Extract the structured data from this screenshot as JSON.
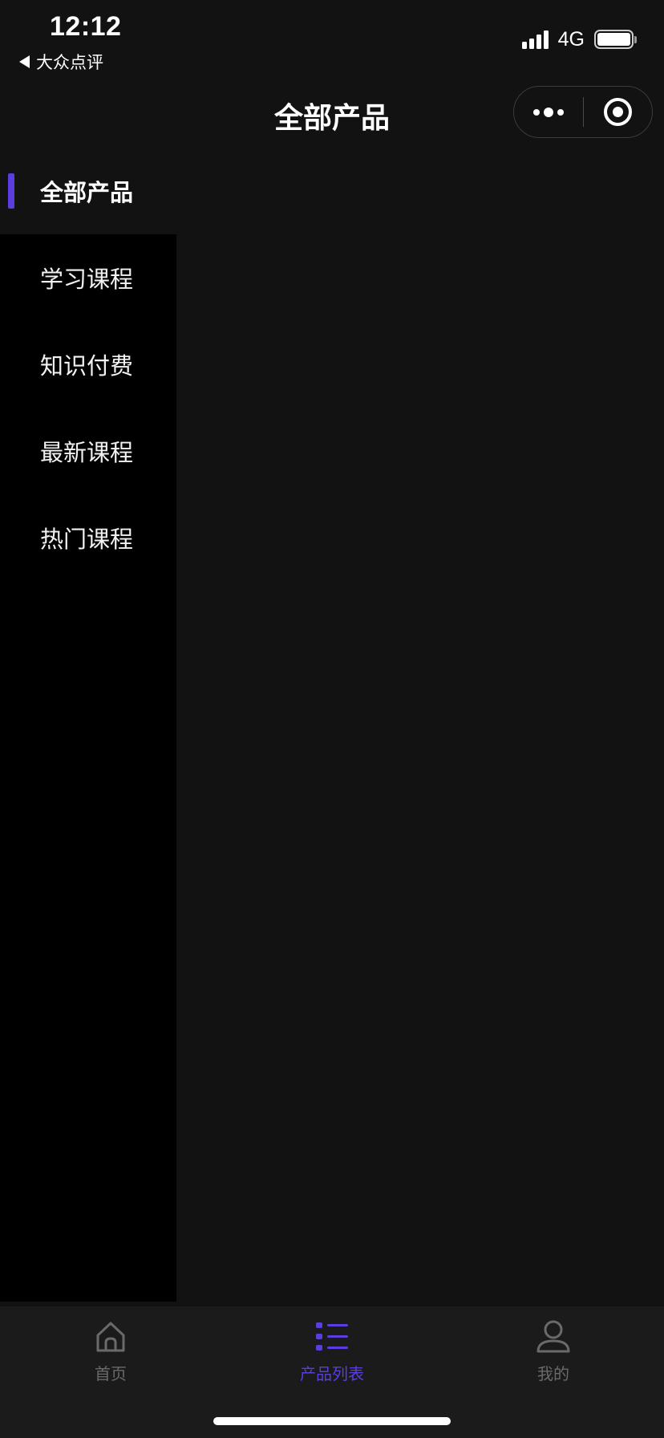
{
  "status_bar": {
    "time": "12:12",
    "back_label": "大众点评",
    "network": "4G"
  },
  "nav": {
    "title": "全部产品"
  },
  "sidebar": {
    "items": [
      {
        "label": "全部产品",
        "active": true
      },
      {
        "label": "学习课程",
        "active": false
      },
      {
        "label": "知识付费",
        "active": false
      },
      {
        "label": "最新课程",
        "active": false
      },
      {
        "label": "热门课程",
        "active": false
      }
    ]
  },
  "tabbar": {
    "tabs": [
      {
        "label": "首页",
        "icon": "home-icon",
        "active": false
      },
      {
        "label": "产品列表",
        "icon": "list-icon",
        "active": true
      },
      {
        "label": "我的",
        "icon": "user-icon",
        "active": false
      }
    ]
  },
  "colors": {
    "accent": "#5b3de0",
    "background": "#121212",
    "sidebar_background": "#000000",
    "tabbar_background": "#1b1b1b",
    "inactive_tab": "#6a6a6a"
  }
}
